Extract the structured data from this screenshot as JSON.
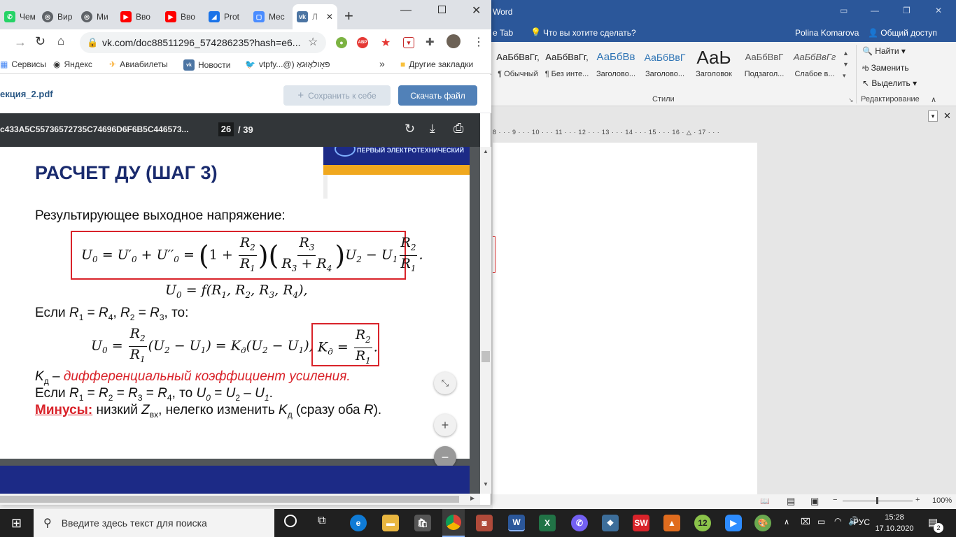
{
  "word": {
    "title": "Word",
    "tabs_fragment": "e Tab",
    "tell_me": "Что вы хотите сделать?",
    "user": "Polina Komarova",
    "share": "Общий доступ",
    "styles": [
      {
        "sample": "АаБбВвГг,",
        "label": "¶ Обычный"
      },
      {
        "sample": "АаБбВвГг,",
        "label": "¶ Без инте..."
      },
      {
        "sample": "АаБбВв",
        "label": "Заголово..."
      },
      {
        "sample": "АаБбВвГ",
        "label": "Заголово..."
      },
      {
        "sample": "АаЬ",
        "label": "Заголовок"
      },
      {
        "sample": "АаБбВвГ",
        "label": "Подзагол..."
      },
      {
        "sample": "АаБбВвГг",
        "label": "Слабое в..."
      }
    ],
    "styles_group": "Стили",
    "editing": {
      "find": "Найти",
      "replace": "Заменить",
      "select": "Выделить",
      "group": "Редактирование"
    },
    "ruler": "8 · · · 9 · · · 10 · · · 11 · · · 12 · · · 13 · · · 14 · · · 15 · · · 16 · △ · 17 · · ·",
    "zoom": "100%"
  },
  "chrome": {
    "tabs": [
      {
        "label": "Чем",
        "icon": "whatsapp-icon",
        "color": "#25d366"
      },
      {
        "label": "Вир",
        "icon": "globe-icon",
        "color": "#5f6368"
      },
      {
        "label": "Ми",
        "icon": "globe-icon",
        "color": "#5f6368"
      },
      {
        "label": "Вво",
        "icon": "youtube-icon",
        "color": "#ff0000"
      },
      {
        "label": "Вво",
        "icon": "youtube-icon",
        "color": "#ff0000"
      },
      {
        "label": "Prot",
        "icon": "protonvpn-icon",
        "color": "#1a73e8"
      },
      {
        "label": "Mec",
        "icon": "messenger-icon",
        "color": "#4a8cff"
      },
      {
        "label": "Л",
        "icon": "vk-icon",
        "color": "#4c75a3"
      }
    ],
    "new_tab": "+",
    "url": "vk.com/doc88511296_574286235?hash=e6...",
    "bookmarks": [
      {
        "label": "Сервисы",
        "icon": "apps-icon"
      },
      {
        "label": "Яндекс",
        "icon": "globe-icon"
      },
      {
        "label": "Авиабилеты",
        "icon": "plane-icon"
      },
      {
        "label": "Новости",
        "icon": "vk-icon"
      },
      {
        "label": "vtpfy...@) פּאָולאָוּגאַ",
        "icon": "twitter-icon"
      }
    ],
    "bookmarks_more": "»",
    "other_bookmarks": "Другие закладки"
  },
  "vk": {
    "filename": "екция_2.pdf",
    "save_button": "Сохранить к себе",
    "download_button": "Скачать файл"
  },
  "pdf": {
    "doc_title": "с433A5C55736572735C74696D6F6B5C446573...",
    "page_current": "26",
    "page_total": "/ 39"
  },
  "slide": {
    "logo_text": "ПЕРВЫЙ ЭЛЕКТРОТЕХНИЧЕСКИЙ",
    "heading": "РАСЧЕТ ДУ (ШАГ 3)",
    "intro": "Результирующее выходное напряжение:",
    "if_text_1": "Если",
    "if_text_2": ", то:",
    "kd_desc": "дифференциальный  коэффициент усиления",
    "if2_text": "Если",
    "minus_label": "Минусы:",
    "minus_text_1": "низкий",
    "minus_text_2": ", нелегко изменить",
    "minus_text_3": "(сразу оба"
  },
  "taskbar": {
    "search_placeholder": "Введите здесь текст для поиска",
    "lang": "РУС",
    "time": "15:28",
    "date": "17.10.2020",
    "notifications": "2"
  }
}
